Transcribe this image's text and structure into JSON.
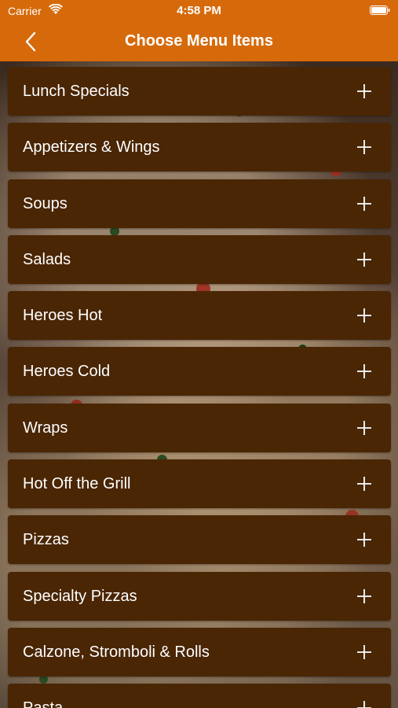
{
  "status_bar": {
    "carrier": "Carrier",
    "time": "4:58 PM",
    "wifi_icon": "wifi-icon",
    "battery_icon": "battery-icon"
  },
  "nav": {
    "back_icon": "chevron-left-icon",
    "title": "Choose Menu Items"
  },
  "menu": {
    "items": [
      {
        "label": "Lunch Specials"
      },
      {
        "label": "Appetizers & Wings"
      },
      {
        "label": "Soups"
      },
      {
        "label": "Salads"
      },
      {
        "label": "Heroes Hot"
      },
      {
        "label": "Heroes Cold"
      },
      {
        "label": "Wraps"
      },
      {
        "label": "Hot Off the Grill"
      },
      {
        "label": "Pizzas"
      },
      {
        "label": "Specialty Pizzas"
      },
      {
        "label": "Calzone, Stromboli & Rolls"
      },
      {
        "label": "Pasta"
      }
    ],
    "expand_icon": "plus-icon"
  },
  "colors": {
    "accent": "#d66a0b",
    "item_background": "#4a2605",
    "text": "#ffffff"
  }
}
